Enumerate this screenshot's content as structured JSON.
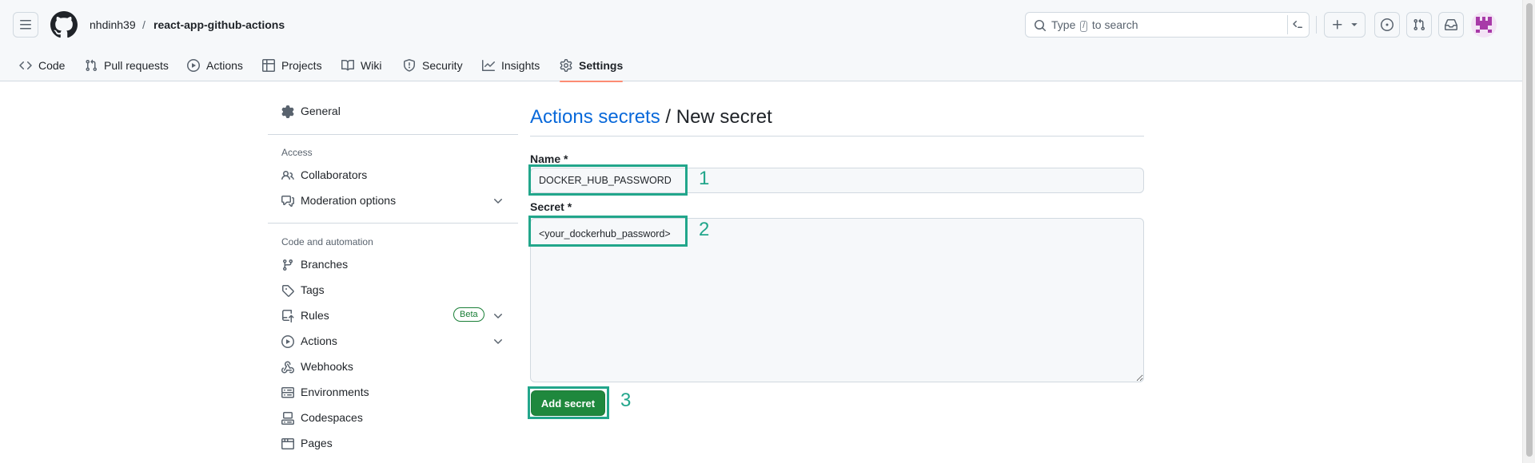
{
  "header": {
    "owner": "nhdinh39",
    "separator": "/",
    "repo": "react-app-github-actions",
    "search_placeholder_before": "Type",
    "search_key": "/",
    "search_placeholder_after": "to search"
  },
  "repo_nav": [
    {
      "label": "Code",
      "icon": "code-icon"
    },
    {
      "label": "Pull requests",
      "icon": "git-pull-request-icon"
    },
    {
      "label": "Actions",
      "icon": "play-icon"
    },
    {
      "label": "Projects",
      "icon": "table-icon"
    },
    {
      "label": "Wiki",
      "icon": "book-icon"
    },
    {
      "label": "Security",
      "icon": "shield-icon"
    },
    {
      "label": "Insights",
      "icon": "graph-icon"
    },
    {
      "label": "Settings",
      "icon": "gear-icon",
      "active": true
    }
  ],
  "sidebar": {
    "general": "General",
    "access_heading": "Access",
    "collaborators": "Collaborators",
    "moderation": "Moderation options",
    "code_heading": "Code and automation",
    "branches": "Branches",
    "tags": "Tags",
    "rules": "Rules",
    "rules_badge": "Beta",
    "actions": "Actions",
    "webhooks": "Webhooks",
    "environments": "Environments",
    "codespaces": "Codespaces",
    "pages": "Pages"
  },
  "main": {
    "title_link": "Actions secrets",
    "title_rest": " / New secret",
    "name_label": "Name *",
    "name_value": "DOCKER_HUB_PASSWORD",
    "secret_label": "Secret *",
    "secret_value": "<your_dockerhub_password>",
    "submit_label": "Add secret"
  },
  "annotations": [
    "1",
    "2",
    "3"
  ],
  "colors": {
    "accent_link": "#0969da",
    "primary_button": "#1f883d",
    "annotation": "#22a68b",
    "active_tab_underline": "#fd8c73"
  }
}
